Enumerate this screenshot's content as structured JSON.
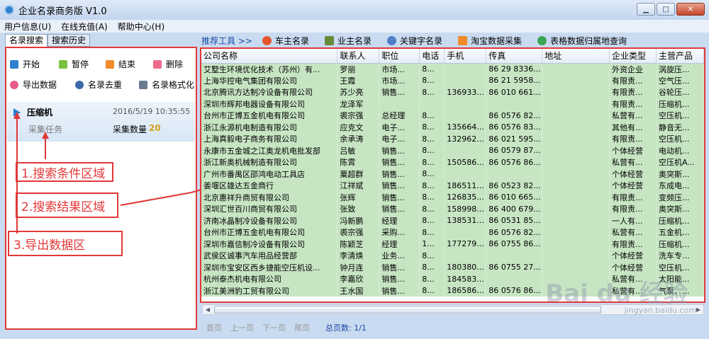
{
  "window": {
    "title": "企业名录商务版 V1.0",
    "minimize": "▁",
    "maximize": "□",
    "close": "✕"
  },
  "menu": [
    "用户信息(U)",
    "在线充值(A)",
    "帮助中心(H)"
  ],
  "left_tabs": [
    "名录搜索",
    "搜索历史"
  ],
  "left_toolbar": {
    "start": "开始",
    "pause": "暂停",
    "stop": "结束",
    "delete": "删除",
    "export": "导出数据",
    "dedupe": "名录去重",
    "format": "名录格式化"
  },
  "task": {
    "name": "压缩机",
    "time": "2016/5/19 10:35:55",
    "sub": "采集任务",
    "count_label": "采集数量",
    "count": "20"
  },
  "annotations": [
    "1.搜索条件区域",
    "2.搜索结果区域",
    "3.导出数据区"
  ],
  "right_toolbar": {
    "label": "推荐工具 >>",
    "items": [
      "车主名录",
      "业主名录",
      "关键字名录",
      "淘宝数据采集",
      "表格数据归属地查询"
    ]
  },
  "columns": [
    "公司名称",
    "联系人",
    "职位",
    "电话",
    "手机",
    "传真",
    "地址",
    "企业类型",
    "主营产品"
  ],
  "rows": [
    [
      "艾墅生环境优化技术（苏州）有...",
      "罗丽",
      "市场...",
      "8...",
      "",
      "86 29 8336...",
      "",
      "外资企业",
      "涡旋压..."
    ],
    [
      "上海华控电气集团有限公司",
      "王霞",
      "市场...",
      "8...",
      "",
      "86 21 5958...",
      "",
      "有限责...",
      "空气压..."
    ],
    [
      "北京腾讯方达制冷设备有限公司",
      "苏少亮",
      "销售...",
      "8...",
      "136933...",
      "86 010 661...",
      "",
      "有限责...",
      "谷轮压..."
    ],
    [
      "深圳市辉邦电器设备有限公司",
      "龙泽军",
      "",
      "",
      "",
      "",
      "",
      "有限责...",
      "压缩机..."
    ],
    [
      "台州市正博五金机电有限公司",
      "裘宗强",
      "总经理",
      "8...",
      "",
      "86 0576 82...",
      "",
      "私营有...",
      "空压机..."
    ],
    [
      "浙江永源机电制造有限公司",
      "应克文",
      "电子...",
      "8...",
      "135664...",
      "86 0576 83...",
      "",
      "其他有...",
      "静音无..."
    ],
    [
      "上海真毅电子商务有限公司",
      "余承涛",
      "电子...",
      "8...",
      "132962...",
      "86 021 595...",
      "",
      "有限责...",
      "空压机..."
    ],
    [
      "永康市五金城之江奥龙机电批发部",
      "吕敏",
      "销售...",
      "8...",
      "",
      "86 0579 87...",
      "",
      "个体经营",
      "电动机..."
    ],
    [
      "浙江新奥机械制造有限公司",
      "陈霄",
      "销售...",
      "8...",
      "150586...",
      "86 0576 86...",
      "",
      "私营有...",
      "空压机A..."
    ],
    [
      "广州市番禺区邵鸿电动工具店",
      "粟超群",
      "销售...",
      "8...",
      "",
      "",
      "",
      "个体经营",
      "奥突斯..."
    ],
    [
      "姜堰区雄达五金商行",
      "江祥斌",
      "销售...",
      "8...",
      "186511...",
      "86 0523 82...",
      "",
      "个体经营",
      "东成电..."
    ],
    [
      "北京惠祥升商贸有限公司",
      "张辉",
      "销售...",
      "8...",
      "126835...",
      "86 010 665...",
      "",
      "有限责...",
      "变频压..."
    ],
    [
      "深圳汇世百川商贸有限公司",
      "张致",
      "销售...",
      "8...",
      "158998...",
      "86 400 679...",
      "",
      "有限责...",
      "奥突斯..."
    ],
    [
      "济南冰晶制冷设备有限公司",
      "冯新鹏",
      "经理",
      "8...",
      "138531...",
      "86 0531 85...",
      "",
      "一人有...",
      "压缩机..."
    ],
    [
      "台州市正博五金机电有限公司",
      "裘宗强",
      "采购...",
      "8...",
      "",
      "86 0576 82...",
      "",
      "私营有...",
      "五金机..."
    ],
    [
      "深圳市嘉信制冷设备有限公司",
      "陈颖芝",
      "经理",
      "1...",
      "177279...",
      "86 0755 86...",
      "",
      "有限责...",
      "压缩机..."
    ],
    [
      "武侯区诚事汽车用品经营部",
      "李清焕",
      "业务...",
      "8...",
      "",
      "",
      "",
      "个体经营",
      "洗车专..."
    ],
    [
      "深圳市宝安区西乡捷能空压机设...",
      "钟月连",
      "销售...",
      "8...",
      "180380...",
      "86 0755 27...",
      "",
      "个体经营",
      "空压机..."
    ],
    [
      "杭州泰杰机电有限公司",
      "李嘉欣",
      "销售...",
      "8...",
      "184583...",
      "",
      "",
      "私营有...",
      "太阳能..."
    ],
    [
      "浙江美洲豹工贸有限公司",
      "王水国",
      "销售...",
      "8...",
      "186586...",
      "86 0576 86...",
      "",
      "私营有...",
      "气泵、..."
    ]
  ],
  "pager": {
    "first": "首页",
    "prev": "上一页",
    "next": "下一页",
    "last": "尾页",
    "total": "总页数: 1/1"
  },
  "watermark": {
    "brand": "Bai du 经验",
    "url": "jingyan.baidu.com"
  }
}
